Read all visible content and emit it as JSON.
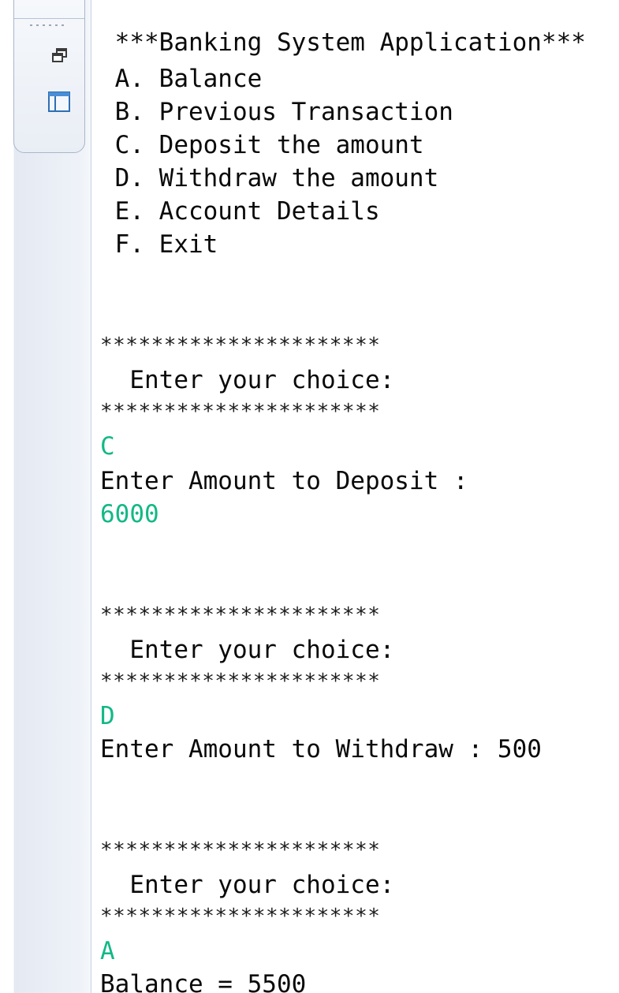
{
  "sidebar": {
    "restore_icon": "restore-window-icon",
    "layout_icon": "window-layout-icon",
    "grip_icon": "grip-dots-icon"
  },
  "console": {
    "menu": {
      "title": " ***Banking System Application***",
      "options": [
        " A. Balance",
        " B. Previous Transaction",
        " C. Deposit the amount",
        " D. Withdraw the amount",
        " E. Account Details",
        " F. Exit"
      ]
    },
    "blocks": [
      {
        "stars_top": "**********************",
        "prompt": "  Enter your choice:",
        "stars_bottom": "**********************",
        "input": "C",
        "message": "Enter Amount to Deposit :",
        "value": "6000"
      },
      {
        "stars_top": "**********************",
        "prompt": "  Enter your choice:",
        "stars_bottom": "**********************",
        "input": "D",
        "message": "Enter Amount to Withdraw : 500"
      },
      {
        "stars_top": "**********************",
        "prompt": "  Enter your choice:",
        "stars_bottom": "**********************",
        "input": "A",
        "message": "Balance = 5500"
      }
    ]
  },
  "colors": {
    "text": "#0a0a0a",
    "user_input": "#12b886",
    "panel_border": "#a9b6c9"
  }
}
